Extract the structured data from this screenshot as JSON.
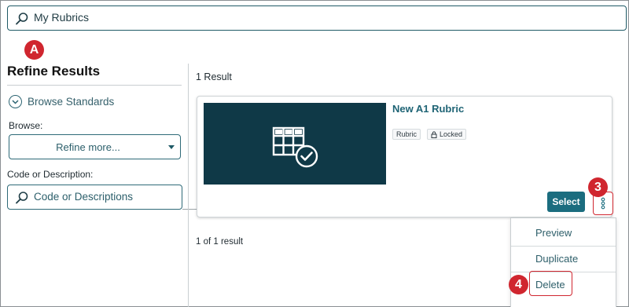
{
  "search": {
    "value": "My Rubrics"
  },
  "callouts": {
    "a": "A",
    "three": "3",
    "four": "4"
  },
  "sidebar": {
    "title": "Refine Results",
    "browse_standards": "Browse Standards",
    "browse_label": "Browse:",
    "browse_select": "Refine more...",
    "code_label": "Code or Description:",
    "code_placeholder": "Code or Descriptions"
  },
  "results": {
    "count_text": "1 Result",
    "pager_text": "1 of 1 result",
    "items": [
      {
        "title": "New A1 Rubric",
        "tags": [
          "Rubric",
          "Locked"
        ],
        "select_label": "Select"
      }
    ]
  },
  "menu": {
    "items": [
      "Preview",
      "Duplicate",
      "Delete"
    ]
  },
  "colors": {
    "accent": "#1b6d7f",
    "thumb_bg": "#0f3947",
    "callout": "#d0262f"
  },
  "icons": [
    "search-icon",
    "chevron-down-circle-icon",
    "caret-down-icon",
    "rubric-check-icon",
    "lock-icon",
    "more-vertical-icon"
  ]
}
